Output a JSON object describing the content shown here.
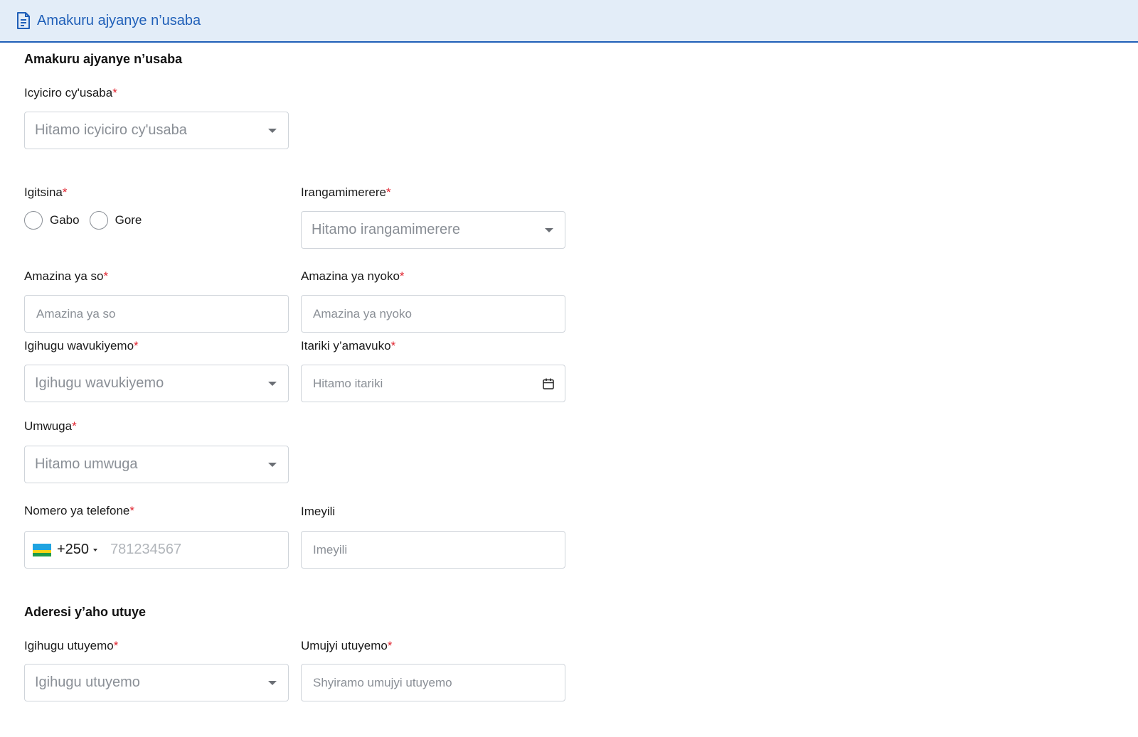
{
  "header": {
    "title": "Amakuru ajyanye n’usaba",
    "icon": "document-icon"
  },
  "section_personal": {
    "title": "Amakuru ajyanye n’usaba"
  },
  "applicant_category": {
    "label": "Icyiciro cy'usaba",
    "placeholder": "Hitamo icyiciro cy'usaba"
  },
  "gender": {
    "label": "Igitsina",
    "options": [
      "Gabo",
      "Gore"
    ]
  },
  "id_type": {
    "label": "Irangamimerere",
    "placeholder": "Hitamo irangamimerere"
  },
  "father_name": {
    "label": "Amazina ya so",
    "placeholder": "Amazina ya so"
  },
  "mother_name": {
    "label": "Amazina ya nyoko",
    "placeholder": "Amazina ya nyoko"
  },
  "birth_country": {
    "label": "Igihugu wavukiyemo",
    "placeholder": "Igihugu wavukiyemo"
  },
  "birth_date": {
    "label": "Itariki y’amavuko",
    "placeholder": "Hitamo itariki"
  },
  "occupation": {
    "label": "Umwuga",
    "placeholder": "Hitamo umwuga"
  },
  "phone": {
    "label": "Nomero ya telefone",
    "dial_code": "+250",
    "placeholder": "781234567"
  },
  "email": {
    "label": "Imeyili",
    "placeholder": "Imeyili"
  },
  "section_address": {
    "title": "Aderesi y’aho utuye"
  },
  "residence_country": {
    "label": "Igihugu utuyemo",
    "placeholder": "Igihugu utuyemo"
  },
  "residence_city": {
    "label": "Umujyi utuyemo",
    "placeholder": "Shyiramo umujyi utuyemo"
  },
  "required_mark": "*",
  "colors": {
    "accent": "#1f5fb8",
    "header_bg": "#e3edf8",
    "required": "#e0242f"
  }
}
